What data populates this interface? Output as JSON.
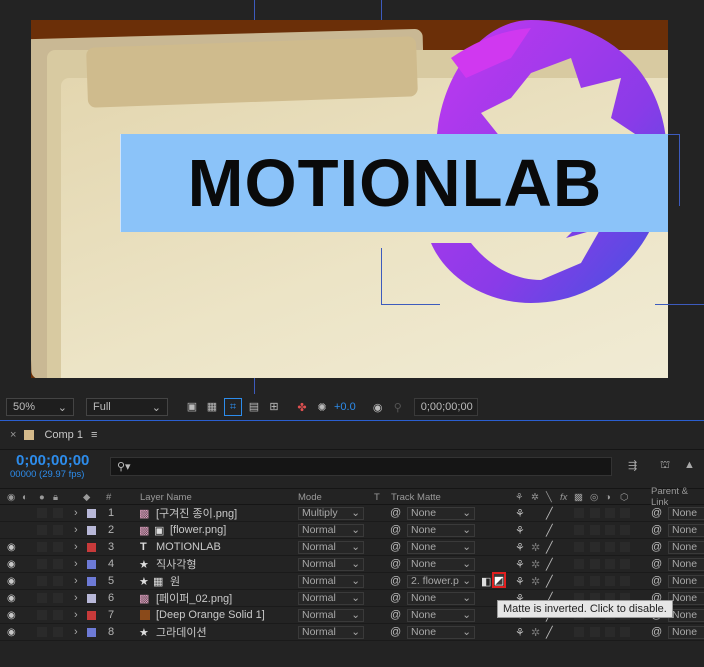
{
  "composition": {
    "title_text": "MOTIONLAB"
  },
  "viewer_toolbar": {
    "zoom": "50%",
    "resolution": "Full",
    "exposure": "+0.0",
    "timecode": "0;00;00;00"
  },
  "timeline": {
    "tab_label": "Comp 1",
    "time": "0;00;00;00",
    "fps": "00000 (29.97 fps)",
    "search_placeholder": "",
    "headers": {
      "num": "#",
      "layer_name": "Layer Name",
      "mode": "Mode",
      "t": "T",
      "track_matte": "Track Matte",
      "parent": "Parent & Link"
    },
    "layers": [
      {
        "num": "1",
        "name": "[구겨진 종이.png]",
        "mode": "Multiply",
        "matte": "None",
        "parent": "None",
        "color": "#b8b8d8",
        "visible": false,
        "type": "image"
      },
      {
        "num": "2",
        "name": "[flower.png]",
        "mode": "Normal",
        "matte": "None",
        "parent": "None",
        "color": "#b8b8d8",
        "visible": false,
        "type": "image2"
      },
      {
        "num": "3",
        "name": "MOTIONLAB",
        "mode": "Normal",
        "matte": "None",
        "parent": "None",
        "color": "#c73a3a",
        "visible": true,
        "type": "text"
      },
      {
        "num": "4",
        "name": "직사각형",
        "mode": "Normal",
        "matte": "None",
        "parent": "None",
        "color": "#6d7ad6",
        "visible": true,
        "type": "shape"
      },
      {
        "num": "5",
        "name": "원",
        "mode": "Normal",
        "matte": "2. flower.p",
        "parent": "None",
        "color": "#6d7ad6",
        "visible": true,
        "type": "shape2"
      },
      {
        "num": "6",
        "name": "[페이퍼_02.png]",
        "mode": "Normal",
        "matte": "None",
        "parent": "None",
        "color": "#b8b8d8",
        "visible": true,
        "type": "image"
      },
      {
        "num": "7",
        "name": "[Deep Orange Solid 1]",
        "mode": "Normal",
        "matte": "None",
        "parent": "None",
        "color": "#c73a3a",
        "visible": true,
        "type": "solid"
      },
      {
        "num": "8",
        "name": "그라데이션",
        "mode": "Normal",
        "matte": "None",
        "parent": "None",
        "color": "#6d7ad6",
        "visible": true,
        "type": "shape"
      }
    ],
    "tooltip": "Matte is inverted. Click to disable."
  },
  "colors": {
    "accent": "#2d8ceb",
    "selection": "#2b5fd0",
    "highlight": "#e02020"
  }
}
